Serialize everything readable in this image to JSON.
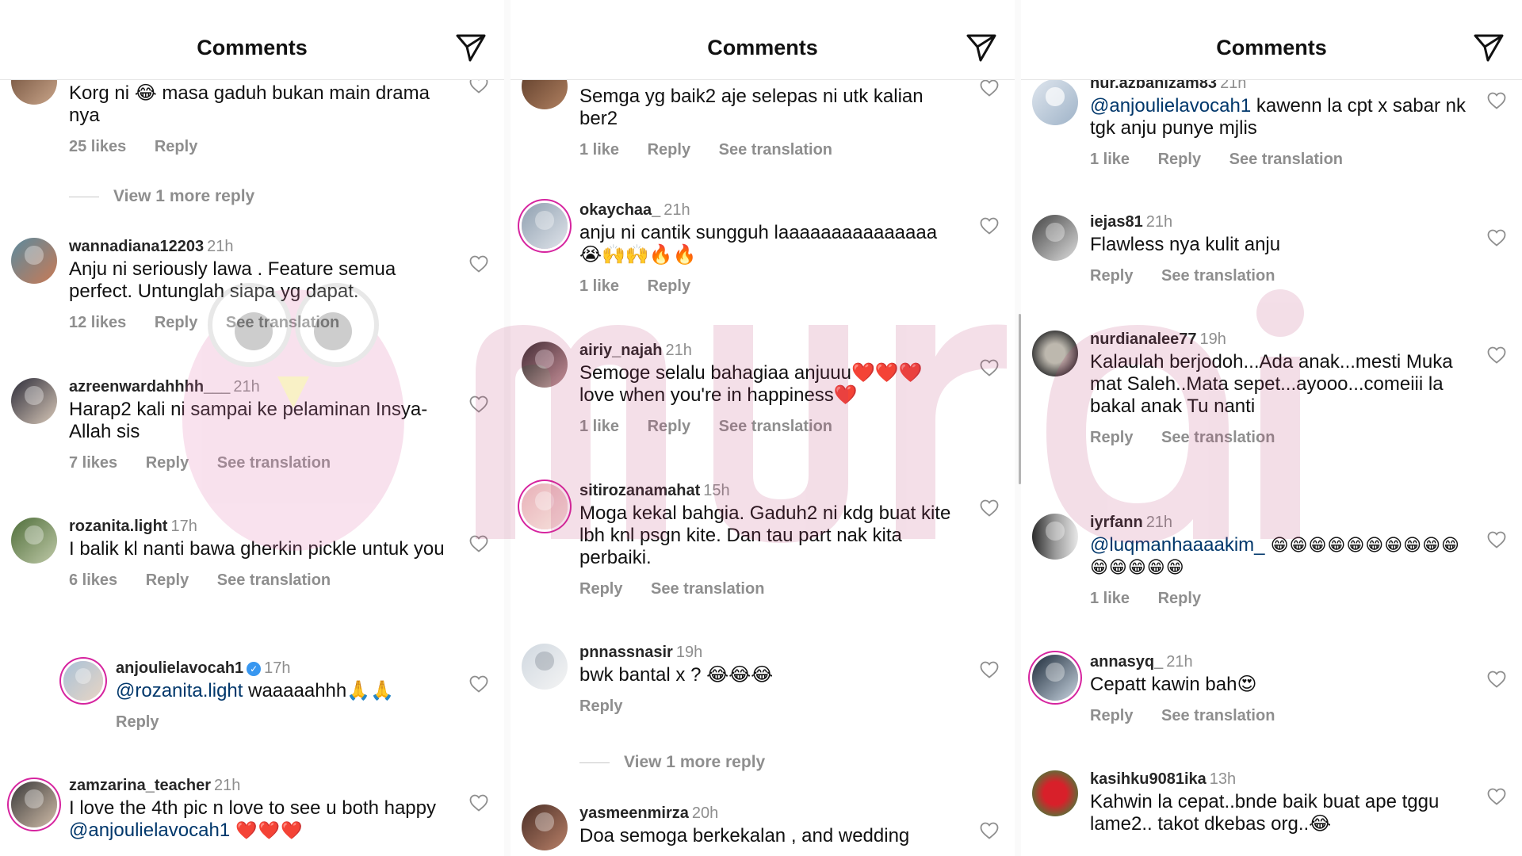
{
  "panels": [
    {
      "title": "Comments",
      "comments": [
        {
          "username": "",
          "time": "",
          "text": "Korg ni 😂 masa gaduh bukan main drama nya",
          "likes": "25 likes",
          "reply": "Reply",
          "translation": ""
        },
        {
          "view_more": "View 1 more reply"
        },
        {
          "username": "wannadiana12203",
          "time": "21h",
          "text": "Anju ni seriously lawa . Feature semua perfect. Untunglah siapa yg dapat.",
          "likes": "12 likes",
          "reply": "Reply",
          "translation": "See translation"
        },
        {
          "username": "azreenwardahhhh___",
          "time": "21h",
          "text": "Harap2 kali ni sampai ke pelaminan Insya-Allah sis",
          "likes": "7 likes",
          "reply": "Reply",
          "translation": "See translation"
        },
        {
          "username": "rozanita.light",
          "time": "17h",
          "text": "I balik kl nanti bawa gherkin pickle untuk you",
          "likes": "6 likes",
          "reply": "Reply",
          "translation": "See translation"
        },
        {
          "username": "anjoulielavocah1",
          "time": "17h",
          "mention": "@rozanita.light",
          "text": " waaaaahhh🙏🙏",
          "likes": "",
          "reply": "Reply",
          "translation": ""
        },
        {
          "username": "zamzarina_teacher",
          "time": "21h",
          "text": "I love the 4th pic n love to see u both happy ",
          "mention_end": "@anjoulielavocah1",
          "emoji_end": " ❤️❤️❤️"
        }
      ]
    },
    {
      "title": "Comments",
      "comments": [
        {
          "username": "",
          "time": "",
          "text": "Semga yg baik2 aje selepas ni utk kalian ber2",
          "likes": "1 like",
          "reply": "Reply",
          "translation": "See translation"
        },
        {
          "username": "okaychaa_",
          "time": "21h",
          "text": "anju ni cantik sungguh laaaaaaaaaaaaaaa 😭🙌🙌🔥🔥",
          "likes": "1 like",
          "reply": "Reply",
          "translation": ""
        },
        {
          "username": "airiy_najah",
          "time": "21h",
          "text": "Semoge selalu bahagiaa anjuuu❤️❤️❤️ love when you're in happiness❤️",
          "likes": "1 like",
          "reply": "Reply",
          "translation": "See translation"
        },
        {
          "username": "sitirozanamahat",
          "time": "15h",
          "text": "Moga kekal bahgia. Gaduh2 ni kdg buat kite lbh knl psgn kite. Dan tau part nak kita perbaiki.",
          "likes": "",
          "reply": "Reply",
          "translation": "See translation"
        },
        {
          "username": "pnnassnasir",
          "time": "19h",
          "text": "bwk bantal x ? 😂😂😂",
          "likes": "",
          "reply": "Reply",
          "translation": ""
        },
        {
          "view_more": "View 1 more reply"
        },
        {
          "username": "yasmeenmirza",
          "time": "20h",
          "text": "Doa semoga berkekalan , and wedding"
        }
      ]
    },
    {
      "title": "Comments",
      "comments": [
        {
          "username": "nur.azbanizam83",
          "time": "21h",
          "mention": "@anjoulielavocah1",
          "text": " kawenn la cpt x sabar nk tgk anju punye mjlis",
          "likes": "1 like",
          "reply": "Reply",
          "translation": "See translation"
        },
        {
          "username": "iejas81",
          "time": "21h",
          "text": "Flawless nya kulit anju",
          "likes": "",
          "reply": "Reply",
          "translation": "See translation"
        },
        {
          "username": "nurdianalee77",
          "time": "19h",
          "text": "Kalaulah berjodoh...Ada anak...mesti Muka mat Saleh..Mata sepet...ayooo...comeiii la bakal anak Tu nanti",
          "likes": "",
          "reply": "Reply",
          "translation": "See translation"
        },
        {
          "username": "iyrfann",
          "time": "21h",
          "mention": "@luqmanhaaaakim_",
          "text": " 😁😁😁😁😁😁😁😁😁😁😁😁😁😁😁",
          "likes": "1 like",
          "reply": "Reply",
          "translation": ""
        },
        {
          "username": "annasyq_",
          "time": "21h",
          "text": "Cepatt kawin bah😍",
          "likes": "",
          "reply": "Reply",
          "translation": "See translation"
        },
        {
          "username": "kasihku9081ika",
          "time": "13h",
          "text": "Kahwin la cepat..bnde baik buat ape tggu lame2.. takot dkebas org..😂"
        }
      ]
    }
  ],
  "watermark": "murai",
  "colors": {
    "mention": "#00376b",
    "muted": "#8e8e8e",
    "ring": "#d6249f",
    "verified": "#3897f0"
  },
  "icons": {
    "send": "send-icon",
    "heart": "heart-icon"
  }
}
